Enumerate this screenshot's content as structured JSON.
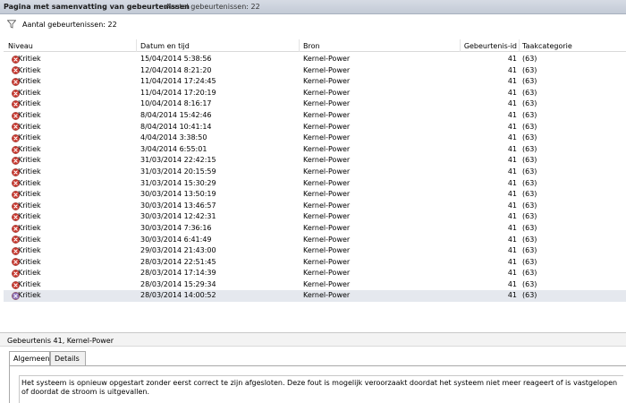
{
  "title_bar": {
    "title": "Pagina met samenvatting van gebeurtenissen",
    "count_label": "Aantal gebeurtenissen: 22"
  },
  "filter_bar": {
    "count_label": "Aantal gebeurtenissen: 22",
    "icon": "filter-icon"
  },
  "grid": {
    "columns": [
      "Niveau",
      "Datum en tijd",
      "Bron",
      "Gebeurtenis-id",
      "Taakcategorie"
    ],
    "rows": [
      {
        "level": "Kritiek",
        "datetime": "15/04/2014 5:38:56",
        "source": "Kernel-Power",
        "event_id": "41",
        "category": "(63)"
      },
      {
        "level": "Kritiek",
        "datetime": "12/04/2014 8:21:20",
        "source": "Kernel-Power",
        "event_id": "41",
        "category": "(63)"
      },
      {
        "level": "Kritiek",
        "datetime": "11/04/2014 17:24:45",
        "source": "Kernel-Power",
        "event_id": "41",
        "category": "(63)"
      },
      {
        "level": "Kritiek",
        "datetime": "11/04/2014 17:20:19",
        "source": "Kernel-Power",
        "event_id": "41",
        "category": "(63)"
      },
      {
        "level": "Kritiek",
        "datetime": "10/04/2014 8:16:17",
        "source": "Kernel-Power",
        "event_id": "41",
        "category": "(63)"
      },
      {
        "level": "Kritiek",
        "datetime": "8/04/2014 15:42:46",
        "source": "Kernel-Power",
        "event_id": "41",
        "category": "(63)"
      },
      {
        "level": "Kritiek",
        "datetime": "8/04/2014 10:41:14",
        "source": "Kernel-Power",
        "event_id": "41",
        "category": "(63)"
      },
      {
        "level": "Kritiek",
        "datetime": "4/04/2014 3:38:50",
        "source": "Kernel-Power",
        "event_id": "41",
        "category": "(63)"
      },
      {
        "level": "Kritiek",
        "datetime": "3/04/2014 6:55:01",
        "source": "Kernel-Power",
        "event_id": "41",
        "category": "(63)"
      },
      {
        "level": "Kritiek",
        "datetime": "31/03/2014 22:42:15",
        "source": "Kernel-Power",
        "event_id": "41",
        "category": "(63)"
      },
      {
        "level": "Kritiek",
        "datetime": "31/03/2014 20:15:59",
        "source": "Kernel-Power",
        "event_id": "41",
        "category": "(63)"
      },
      {
        "level": "Kritiek",
        "datetime": "31/03/2014 15:30:29",
        "source": "Kernel-Power",
        "event_id": "41",
        "category": "(63)"
      },
      {
        "level": "Kritiek",
        "datetime": "30/03/2014 13:50:19",
        "source": "Kernel-Power",
        "event_id": "41",
        "category": "(63)"
      },
      {
        "level": "Kritiek",
        "datetime": "30/03/2014 13:46:57",
        "source": "Kernel-Power",
        "event_id": "41",
        "category": "(63)"
      },
      {
        "level": "Kritiek",
        "datetime": "30/03/2014 12:42:31",
        "source": "Kernel-Power",
        "event_id": "41",
        "category": "(63)"
      },
      {
        "level": "Kritiek",
        "datetime": "30/03/2014 7:36:16",
        "source": "Kernel-Power",
        "event_id": "41",
        "category": "(63)"
      },
      {
        "level": "Kritiek",
        "datetime": "30/03/2014 6:41:49",
        "source": "Kernel-Power",
        "event_id": "41",
        "category": "(63)"
      },
      {
        "level": "Kritiek",
        "datetime": "29/03/2014 21:43:00",
        "source": "Kernel-Power",
        "event_id": "41",
        "category": "(63)"
      },
      {
        "level": "Kritiek",
        "datetime": "28/03/2014 22:51:45",
        "source": "Kernel-Power",
        "event_id": "41",
        "category": "(63)"
      },
      {
        "level": "Kritiek",
        "datetime": "28/03/2014 17:14:39",
        "source": "Kernel-Power",
        "event_id": "41",
        "category": "(63)"
      },
      {
        "level": "Kritiek",
        "datetime": "28/03/2014 15:29:34",
        "source": "Kernel-Power",
        "event_id": "41",
        "category": "(63)"
      },
      {
        "level": "Kritiek",
        "datetime": "28/03/2014 14:00:52",
        "source": "Kernel-Power",
        "event_id": "41",
        "category": "(63)"
      }
    ],
    "selected_row": 21,
    "error_icon_color": "#c8382f",
    "selected_icon_color": "#8a6fb5",
    "selected_row_color": "#e5e8ee"
  },
  "detail": {
    "title": "Gebeurtenis 41, Kernel-Power",
    "tabs": [
      "Algemeen",
      "Details"
    ],
    "active_tab": 0,
    "message": "Het systeem is opnieuw opgestart zonder eerst correct te zijn afgesloten. Deze fout is mogelijk veroorzaakt doordat het systeem niet meer reageert of is vastgelopen of doordat de stroom is uitgevallen."
  }
}
